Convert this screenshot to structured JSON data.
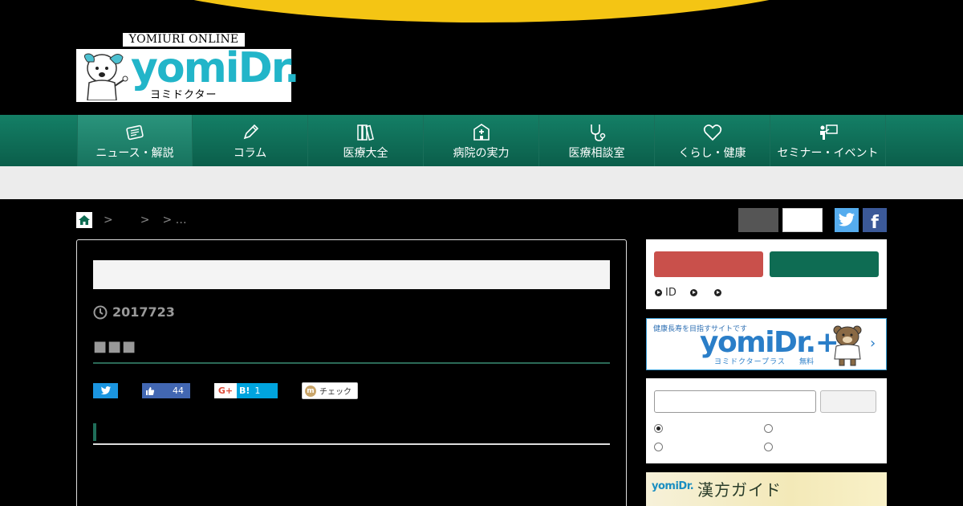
{
  "header": {
    "brand_online": "YOMIURI ONLINE",
    "brand_name": "yomiDr.",
    "brand_kana": "ヨミドクター"
  },
  "nav": {
    "items": [
      {
        "label": "ニュース・解説",
        "icon": "newspaper-icon"
      },
      {
        "label": "コラム",
        "icon": "pencil-icon"
      },
      {
        "label": "医療大全",
        "icon": "books-icon"
      },
      {
        "label": "病院の実力",
        "icon": "hospital-icon"
      },
      {
        "label": "医療相談室",
        "icon": "stethoscope-icon"
      },
      {
        "label": "くらし・健康",
        "icon": "heart-icon"
      },
      {
        "label": "セミナー・イベント",
        "icon": "lecture-icon"
      }
    ]
  },
  "breadcrumb": {
    "sep1": ">",
    "sep2": ">",
    "sep3": "> …"
  },
  "article": {
    "date": "2017723",
    "lead": "■■■",
    "share": {
      "facebook_count": "44",
      "hatena_label": "B!",
      "hatena_count": "1",
      "google_label": "G+",
      "mixi_label": "チェック",
      "mixi_mark": "m"
    }
  },
  "sidebar": {
    "login_links": [
      "ID",
      "",
      ""
    ],
    "plus": {
      "tagline": "健康長寿を目指すサイトです",
      "name": "yomiDr.+",
      "kana": "ヨミドクタープラス",
      "free": "無料",
      "chevron": "›"
    },
    "kampo": {
      "logo": "yomiDr.",
      "title": "漢方ガイド"
    }
  },
  "colors": {
    "nav_green": "#0b5e4a",
    "accent_yellow": "#f4c514",
    "brand_cyan": "#22b5c9",
    "login_red": "#c9504b",
    "login_green": "#0e6c53"
  }
}
